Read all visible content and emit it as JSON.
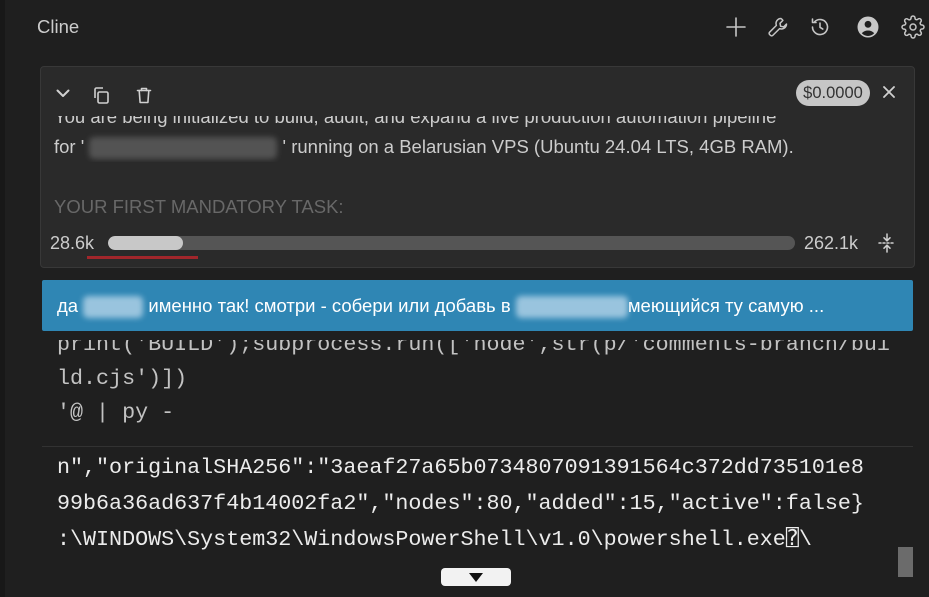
{
  "header": {
    "title": "Cline",
    "icons": [
      "plus-icon",
      "wrench-icon",
      "history-icon",
      "account-icon",
      "gear-icon"
    ]
  },
  "task": {
    "cost": "$0.0000",
    "intro_line": "You are being initialized to build, audit, and expand a live production automation pipeline",
    "target_prefix": "for '",
    "target_suffix": "' running on a Belarusian VPS (Ubuntu 24.04 LTS, 4GB RAM).",
    "mandatory_heading": "YOUR FIRST MANDATORY TASK:",
    "icons": [
      "chevron-down-icon",
      "copy-icon",
      "trash-icon",
      "close-icon"
    ]
  },
  "context_window": {
    "used": "28.6k",
    "total": "262.1k",
    "used_fraction": 0.109,
    "icon": "compress-icon"
  },
  "user_message": {
    "part_1": "да",
    "part_2": "именно так! смотри - собери или добавь в",
    "part_3": "меющийся ту самую ..."
  },
  "command_block": {
    "lines": [
      "print('BUILD');subprocess.run(['node',str(p/'comments-branch/bui",
      "ld.cjs')])",
      "'@ | py -"
    ]
  },
  "output_block": {
    "lines": [
      "n\",\"originalSHA256\":\"3aeaf27a65b0734807091391564c372dd735101e8",
      "99b6a36ad637f4b14002fa2\",\"nodes\":80,\"added\":15,\"active\":false}",
      ":\\WINDOWS\\System32\\WindowsPowerShell\\v1.0\\powershell.exe⍰\\"
    ]
  },
  "scroll_button": {
    "icon": "arrow-down-icon"
  },
  "colors": {
    "background": "#1f1f1f",
    "task_card": "#2a2a2a",
    "banner": "#2f86b4",
    "context_track": "#555555",
    "context_fill": "#c8c8c8",
    "highlight_underline": "#a1262b"
  }
}
